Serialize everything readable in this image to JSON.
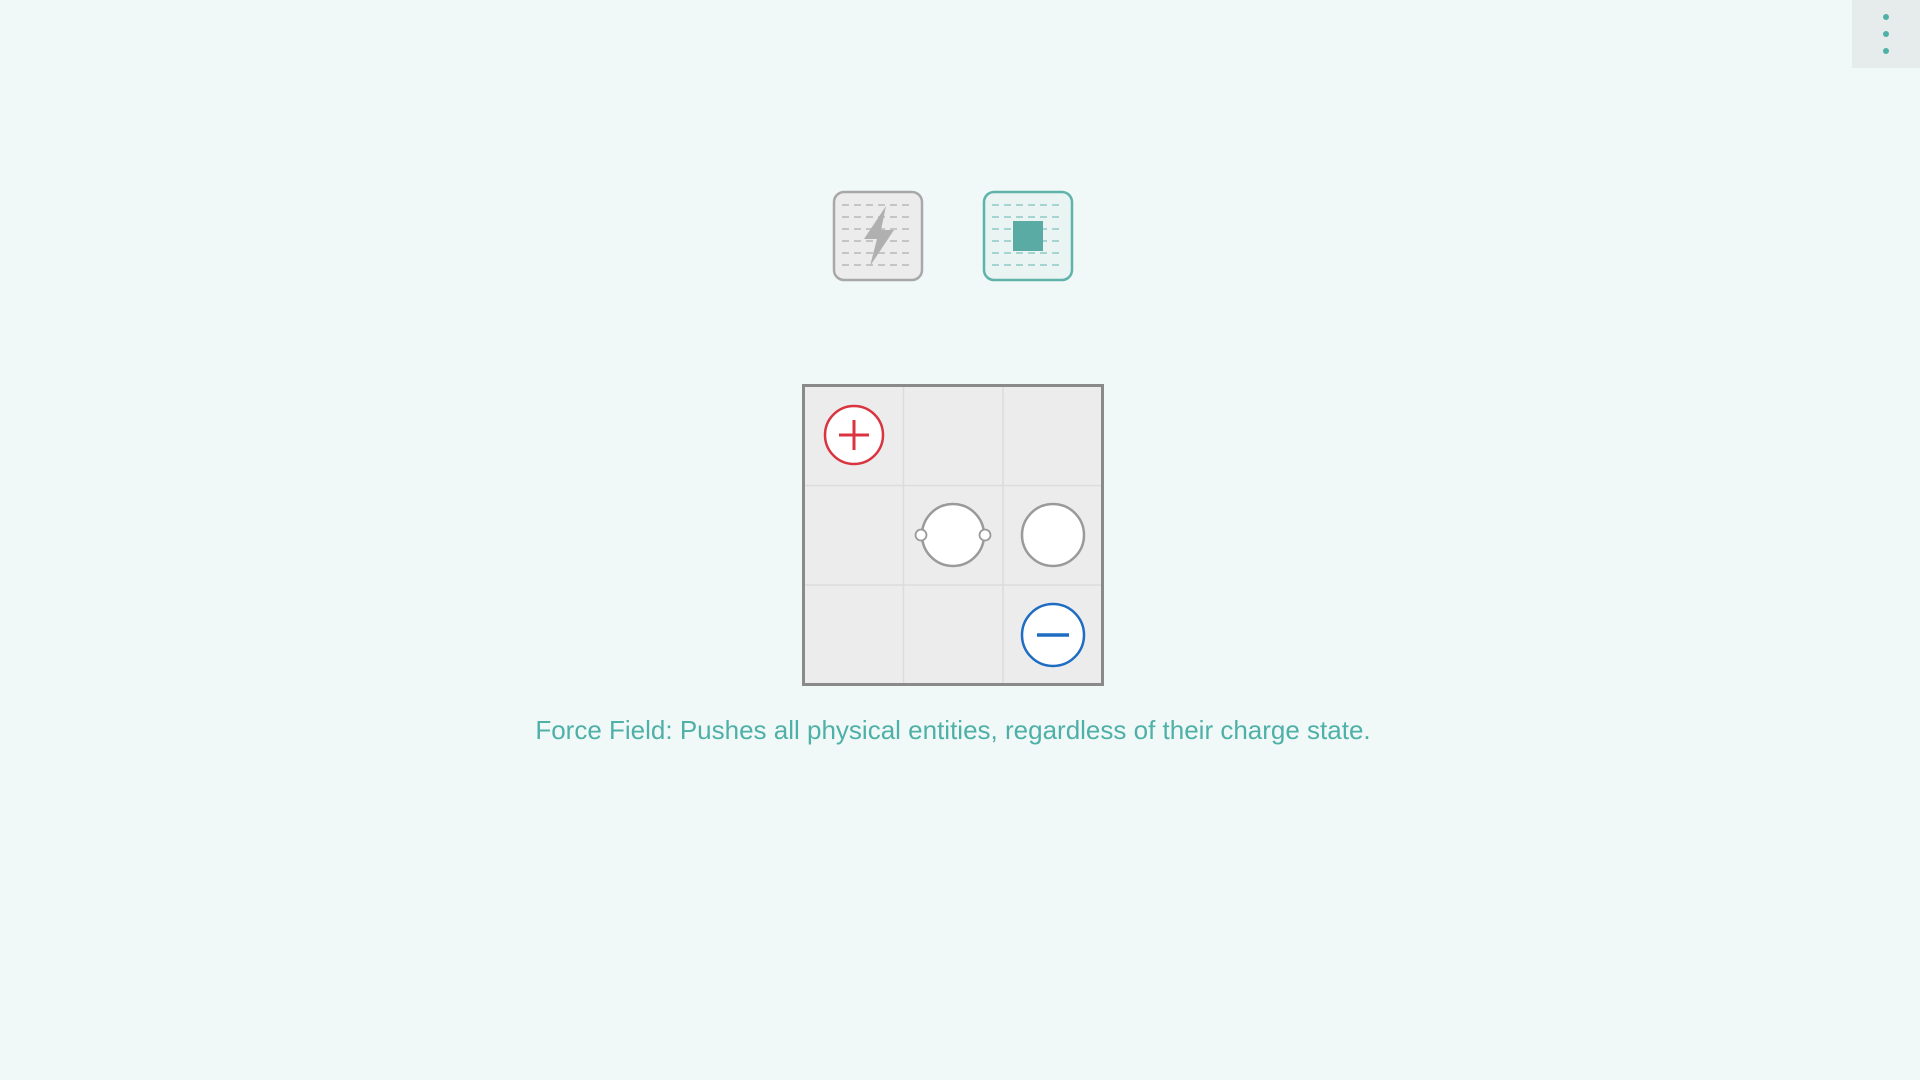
{
  "menu": {
    "icon": "vertical-ellipsis-icon"
  },
  "toolbar": {
    "tools": [
      {
        "name": "charge-tool",
        "icon": "lightning-bolt-icon",
        "selected": false
      },
      {
        "name": "force-field-tool",
        "icon": "filled-square-icon",
        "selected": true
      }
    ]
  },
  "board": {
    "rows": 3,
    "cols": 3,
    "cells": [
      [
        "positive-charge",
        "empty",
        "empty"
      ],
      [
        "empty",
        "neutral-linked-particle",
        "neutral-particle"
      ],
      [
        "empty",
        "empty",
        "negative-charge"
      ]
    ]
  },
  "caption": {
    "text": "Force Field: Pushes all physical entities, regardless of their charge state."
  },
  "colors": {
    "background": "#f0f9f8",
    "accent": "#4fb0a7",
    "positive": "#d9343f",
    "negative": "#1f6dc2",
    "cell": "#ececec",
    "board_border": "#8a8a8a",
    "inactive_tool": "#a8a8a8"
  }
}
